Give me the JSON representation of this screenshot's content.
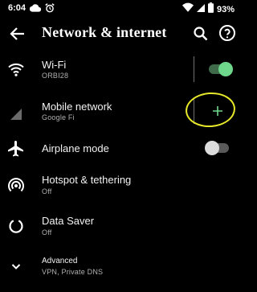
{
  "status_bar": {
    "time": "6:04",
    "battery_percent": "93%",
    "icons": [
      "cloud-notification-icon",
      "alarm-icon",
      "wifi-signal-icon",
      "cellular-signal-icon",
      "battery-icon"
    ]
  },
  "header": {
    "title": "Network & internet",
    "back_icon": "back-arrow-icon",
    "search_icon": "search-icon",
    "help_icon": "help-icon"
  },
  "rows": [
    {
      "id": "wifi",
      "title": "Wi-Fi",
      "subtitle": "ORBI28",
      "icon": "wifi-icon",
      "control": "toggle",
      "toggle_on": true
    },
    {
      "id": "mobile-network",
      "title": "Mobile network",
      "subtitle": "Google Fi",
      "icon": "cellular-signal-icon",
      "control": "plus"
    },
    {
      "id": "airplane-mode",
      "title": "Airplane mode",
      "subtitle": "",
      "icon": "airplane-icon",
      "control": "toggle",
      "toggle_on": false
    },
    {
      "id": "hotspot",
      "title": "Hotspot & tethering",
      "subtitle": "Off",
      "icon": "hotspot-icon"
    },
    {
      "id": "data-saver",
      "title": "Data Saver",
      "subtitle": "Off",
      "icon": "data-saver-icon"
    },
    {
      "id": "advanced",
      "title": "Advanced",
      "subtitle": "VPN, Private DNS",
      "icon": "chevron-down-icon"
    }
  ],
  "colors": {
    "background": "#000000",
    "toggle_on_track": "#3f6b4a",
    "toggle_on_thumb": "#6fd78c",
    "toggle_off_track": "#5a5a5a",
    "toggle_off_thumb": "#dcdcdc",
    "accent": "#6fd78c",
    "annotation": "#e8e82a"
  }
}
